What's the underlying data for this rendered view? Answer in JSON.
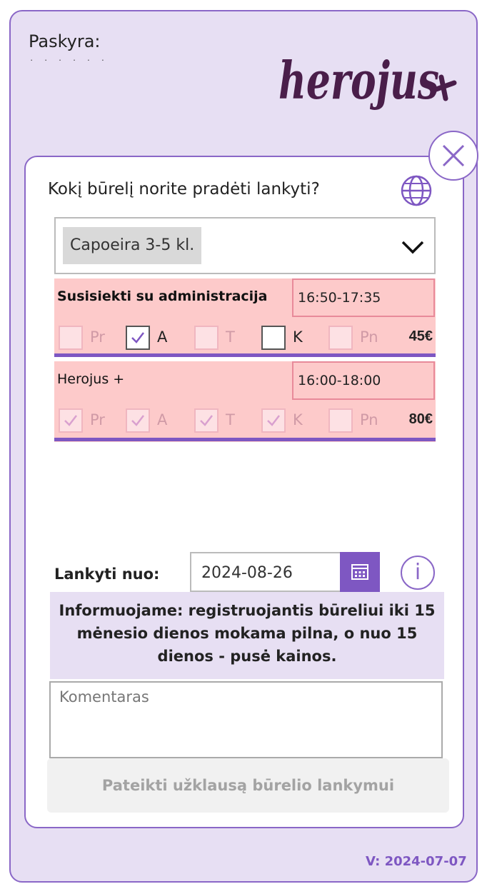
{
  "header": {
    "account_label": "Paskyra:",
    "account_name": "· · · · · ·",
    "logo_text": "herojus+"
  },
  "form": {
    "question": "Kokį būrelį norite pradėti lankyti?",
    "activity_select": {
      "selected": "Capoeira 3-5 kl."
    },
    "groups": [
      {
        "name": "Susisiekti su administracija",
        "time": "16:50-17:35",
        "days": [
          {
            "label": "Pr",
            "checked": false,
            "enabled": false
          },
          {
            "label": "A",
            "checked": true,
            "enabled": true
          },
          {
            "label": "T",
            "checked": false,
            "enabled": false
          },
          {
            "label": "K",
            "checked": false,
            "enabled": true
          },
          {
            "label": "Pn",
            "checked": false,
            "enabled": false
          }
        ],
        "price": "45€"
      },
      {
        "name": "Herojus +",
        "time": "16:00-18:00",
        "days": [
          {
            "label": "Pr",
            "checked": true,
            "enabled": false
          },
          {
            "label": "A",
            "checked": true,
            "enabled": false
          },
          {
            "label": "T",
            "checked": true,
            "enabled": false
          },
          {
            "label": "K",
            "checked": true,
            "enabled": false
          },
          {
            "label": "Pn",
            "checked": false,
            "enabled": false
          }
        ],
        "price": "80€"
      }
    ],
    "start_label": "Lankyti nuo:",
    "start_date": "2024-08-26",
    "notice": "Informuojame: registruojantis būreliui iki 15 mėnesio dienos mokama pilna, o nuo 15 dienos - pusė kainos.",
    "comment_placeholder": "Komentaras",
    "submit_label": "Pateikti užklausą būrelio lankymui"
  },
  "footer": {
    "version": "V: 2024-07-07"
  },
  "colors": {
    "accent": "#7e57c2",
    "group_bg": "#fdcaca",
    "panel_bg": "#e7dff3"
  }
}
